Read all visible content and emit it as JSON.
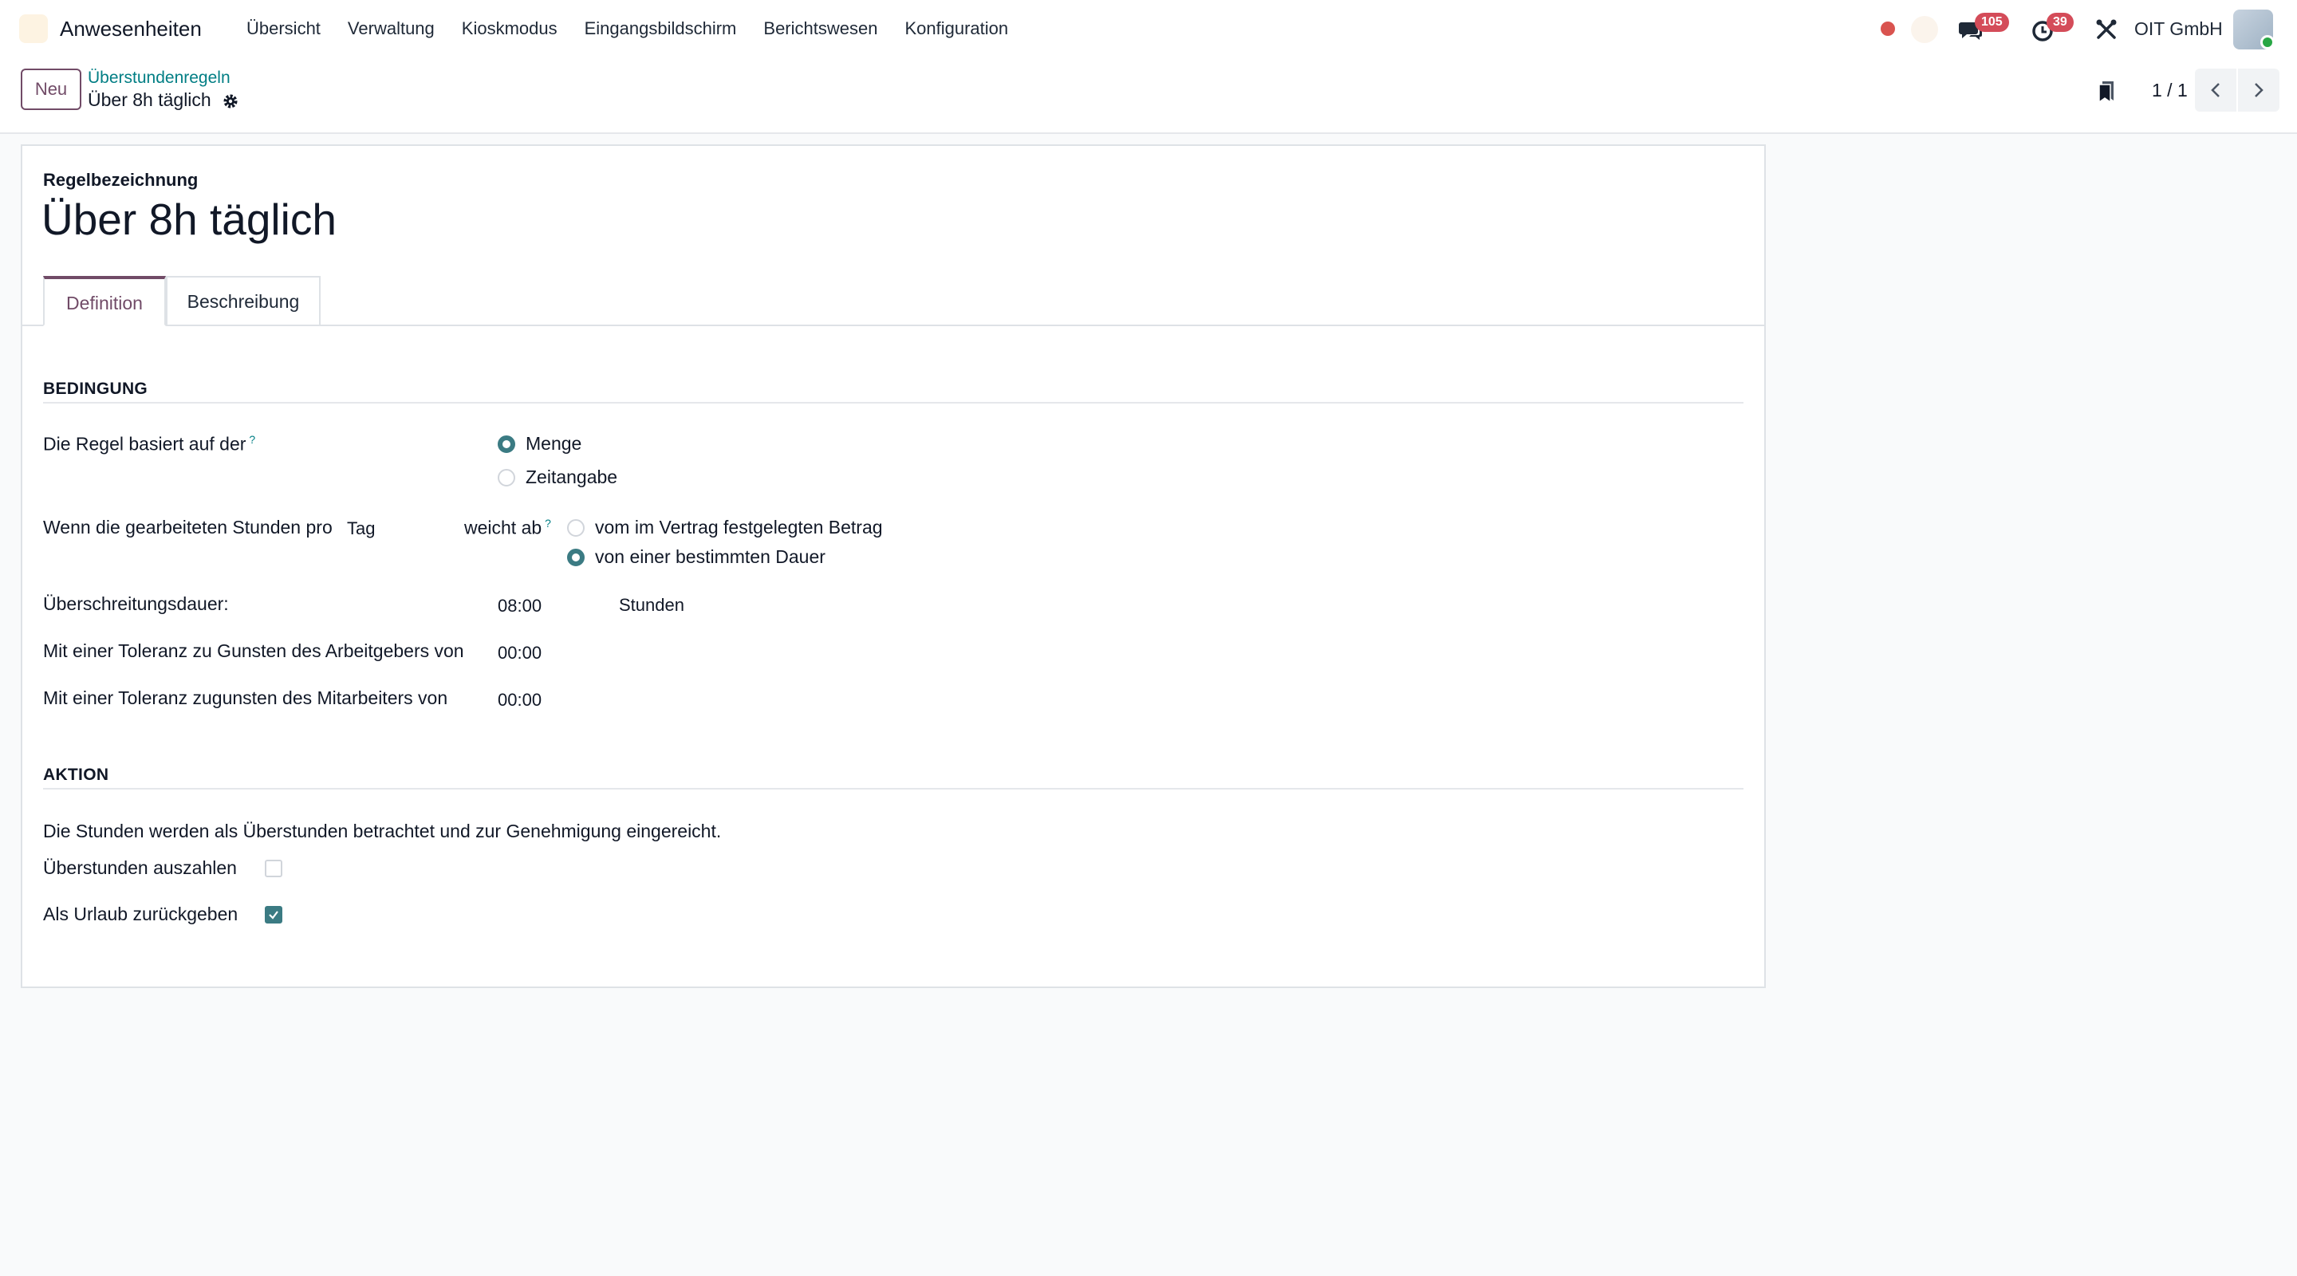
{
  "navbar": {
    "app_name": "Anwesenheiten",
    "menu": [
      "Übersicht",
      "Verwaltung",
      "Kioskmodus",
      "Eingangsbildschirm",
      "Berichtswesen",
      "Konfiguration"
    ],
    "messages_count": "105",
    "activities_count": "39",
    "company": "OIT GmbH"
  },
  "control": {
    "new_label": "Neu",
    "breadcrumb": "Überstundenregeln",
    "record_name": "Über 8h täglich",
    "pager": "1 / 1"
  },
  "form": {
    "title_label": "Regelbezeichnung",
    "title": "Über 8h täglich",
    "tabs": [
      "Definition",
      "Beschreibung"
    ],
    "condition": {
      "section": "BEDINGUNG",
      "based_on_label": "Die Regel basiert auf der",
      "based_on_options": [
        "Menge",
        "Zeitangabe"
      ],
      "based_on_selected": "Menge",
      "worked_hours_label": "Wenn die gearbeiteten Stunden pro",
      "period_value": "Tag",
      "deviates_label": "weicht ab",
      "deviation_options": [
        "vom im Vertrag festgelegten Betrag",
        "von einer bestimmten Dauer"
      ],
      "deviation_selected": "von einer bestimmten Dauer",
      "exceed_label": "Überschreitungsdauer:",
      "exceed_value": "08:00",
      "exceed_unit": "Stunden",
      "tol_employer_label": "Mit einer Toleranz zu Gunsten des Arbeitgebers von",
      "tol_employer_value": "00:00",
      "tol_employee_label": "Mit einer Toleranz zugunsten des Mitarbeiters von",
      "tol_employee_value": "00:00"
    },
    "action": {
      "section": "AKTION",
      "description": "Die Stunden werden als Überstunden betrachtet und zur Genehmigung eingereicht.",
      "pay_label": "Überstunden auszahlen",
      "pay_checked": false,
      "leave_label": "Als Urlaub zurückgeben",
      "leave_checked": true
    }
  },
  "colors": {
    "primary": "#714b67",
    "link": "#017e84",
    "accent": "#3b7b83",
    "badge": "#d44c59"
  }
}
